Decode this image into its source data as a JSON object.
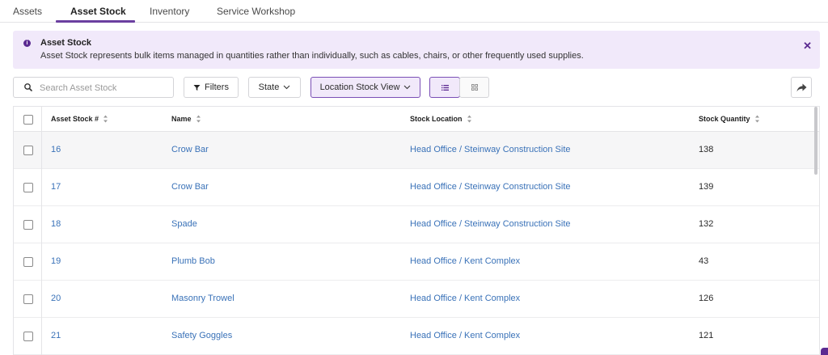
{
  "tabs": [
    {
      "label": "Assets",
      "active": false
    },
    {
      "label": "Asset Stock",
      "active": true
    },
    {
      "label": "Inventory",
      "active": false
    },
    {
      "label": "Service Workshop",
      "active": false
    }
  ],
  "banner": {
    "icon": "info-icon",
    "title": "Asset Stock",
    "text": "Asset Stock represents bulk items managed in quantities rather than individually, such as cables, chairs, or other frequently used supplies.",
    "close_icon": "close-icon"
  },
  "toolbar": {
    "search_placeholder": "Search Asset Stock",
    "filters_label": "Filters",
    "state_label": "State",
    "location_view_label": "Location Stock View",
    "list_view_icon": "list-icon",
    "grid_view_icon": "grid-icon",
    "share_icon": "share-arrow-icon"
  },
  "table": {
    "columns": [
      "Asset Stock #",
      "Name",
      "Stock Location",
      "Stock Quantity"
    ],
    "rows": [
      {
        "id": "16",
        "name": "Crow Bar",
        "location": "Head Office / Steinway Construction Site",
        "quantity": "138"
      },
      {
        "id": "17",
        "name": "Crow Bar",
        "location": "Head Office / Steinway Construction Site",
        "quantity": "139"
      },
      {
        "id": "18",
        "name": "Spade",
        "location": "Head Office / Steinway Construction Site",
        "quantity": "132"
      },
      {
        "id": "19",
        "name": "Plumb Bob",
        "location": "Head Office / Kent Complex",
        "quantity": "43"
      },
      {
        "id": "20",
        "name": "Masonry Trowel",
        "location": "Head Office / Kent Complex",
        "quantity": "126"
      },
      {
        "id": "21",
        "name": "Safety Goggles",
        "location": "Head Office / Kent Complex",
        "quantity": "121"
      }
    ]
  },
  "colors": {
    "accent": "#6b3fa0",
    "banner_bg": "#f1e9fa",
    "link": "#3a72b8"
  }
}
